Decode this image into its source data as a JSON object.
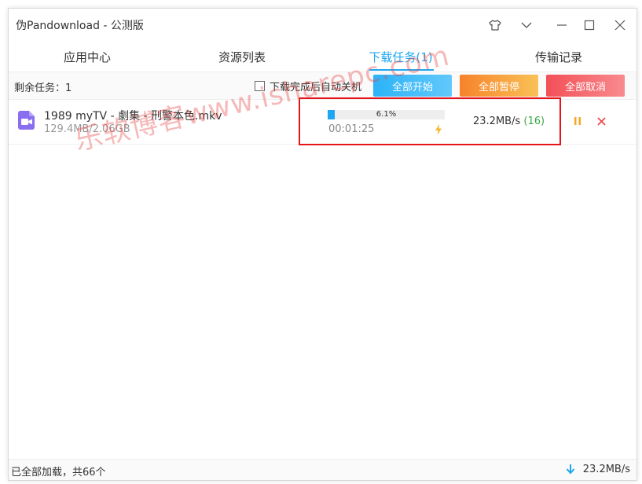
{
  "window": {
    "title": "伪Pandownload - 公测版"
  },
  "titlebar_icons": [
    "shirt-icon",
    "chevron-down-icon",
    "minimize-icon",
    "maximize-icon",
    "close-icon"
  ],
  "tabs": [
    {
      "label": "应用中心",
      "active": false
    },
    {
      "label": "资源列表",
      "active": false
    },
    {
      "label": "下载任务(1)",
      "active": true
    },
    {
      "label": "传输记录",
      "active": false
    }
  ],
  "toolbar": {
    "remaining": "剩余任务：1",
    "auto_shutdown_label": "下载完成后自动关机",
    "auto_shutdown_checked": false,
    "start_all": "全部开始",
    "pause_all": "全部暂停",
    "cancel_all": "全部取消"
  },
  "task": {
    "filename": "1989 myTV - 劇集 - 刑警本色.mkv",
    "size": "129.4MB/2.06GB",
    "progress_percent": 6.1,
    "progress_label": "6.1%",
    "elapsed": "00:01:25",
    "speed": "23.2MB/s",
    "connections": "(16)"
  },
  "watermark": "乐软博客www.isharepc.com",
  "status": {
    "left": "已全部加载，共66个",
    "total_speed": "23.2MB/s"
  },
  "colors": {
    "accent": "#1da7f2",
    "start_btn": "#2cb3f8",
    "pause_btn": "#f7822a",
    "cancel_btn": "#f25056",
    "connections": "#39a845",
    "highlight": "#e5141c",
    "video_icon": "#8a6ef0"
  }
}
